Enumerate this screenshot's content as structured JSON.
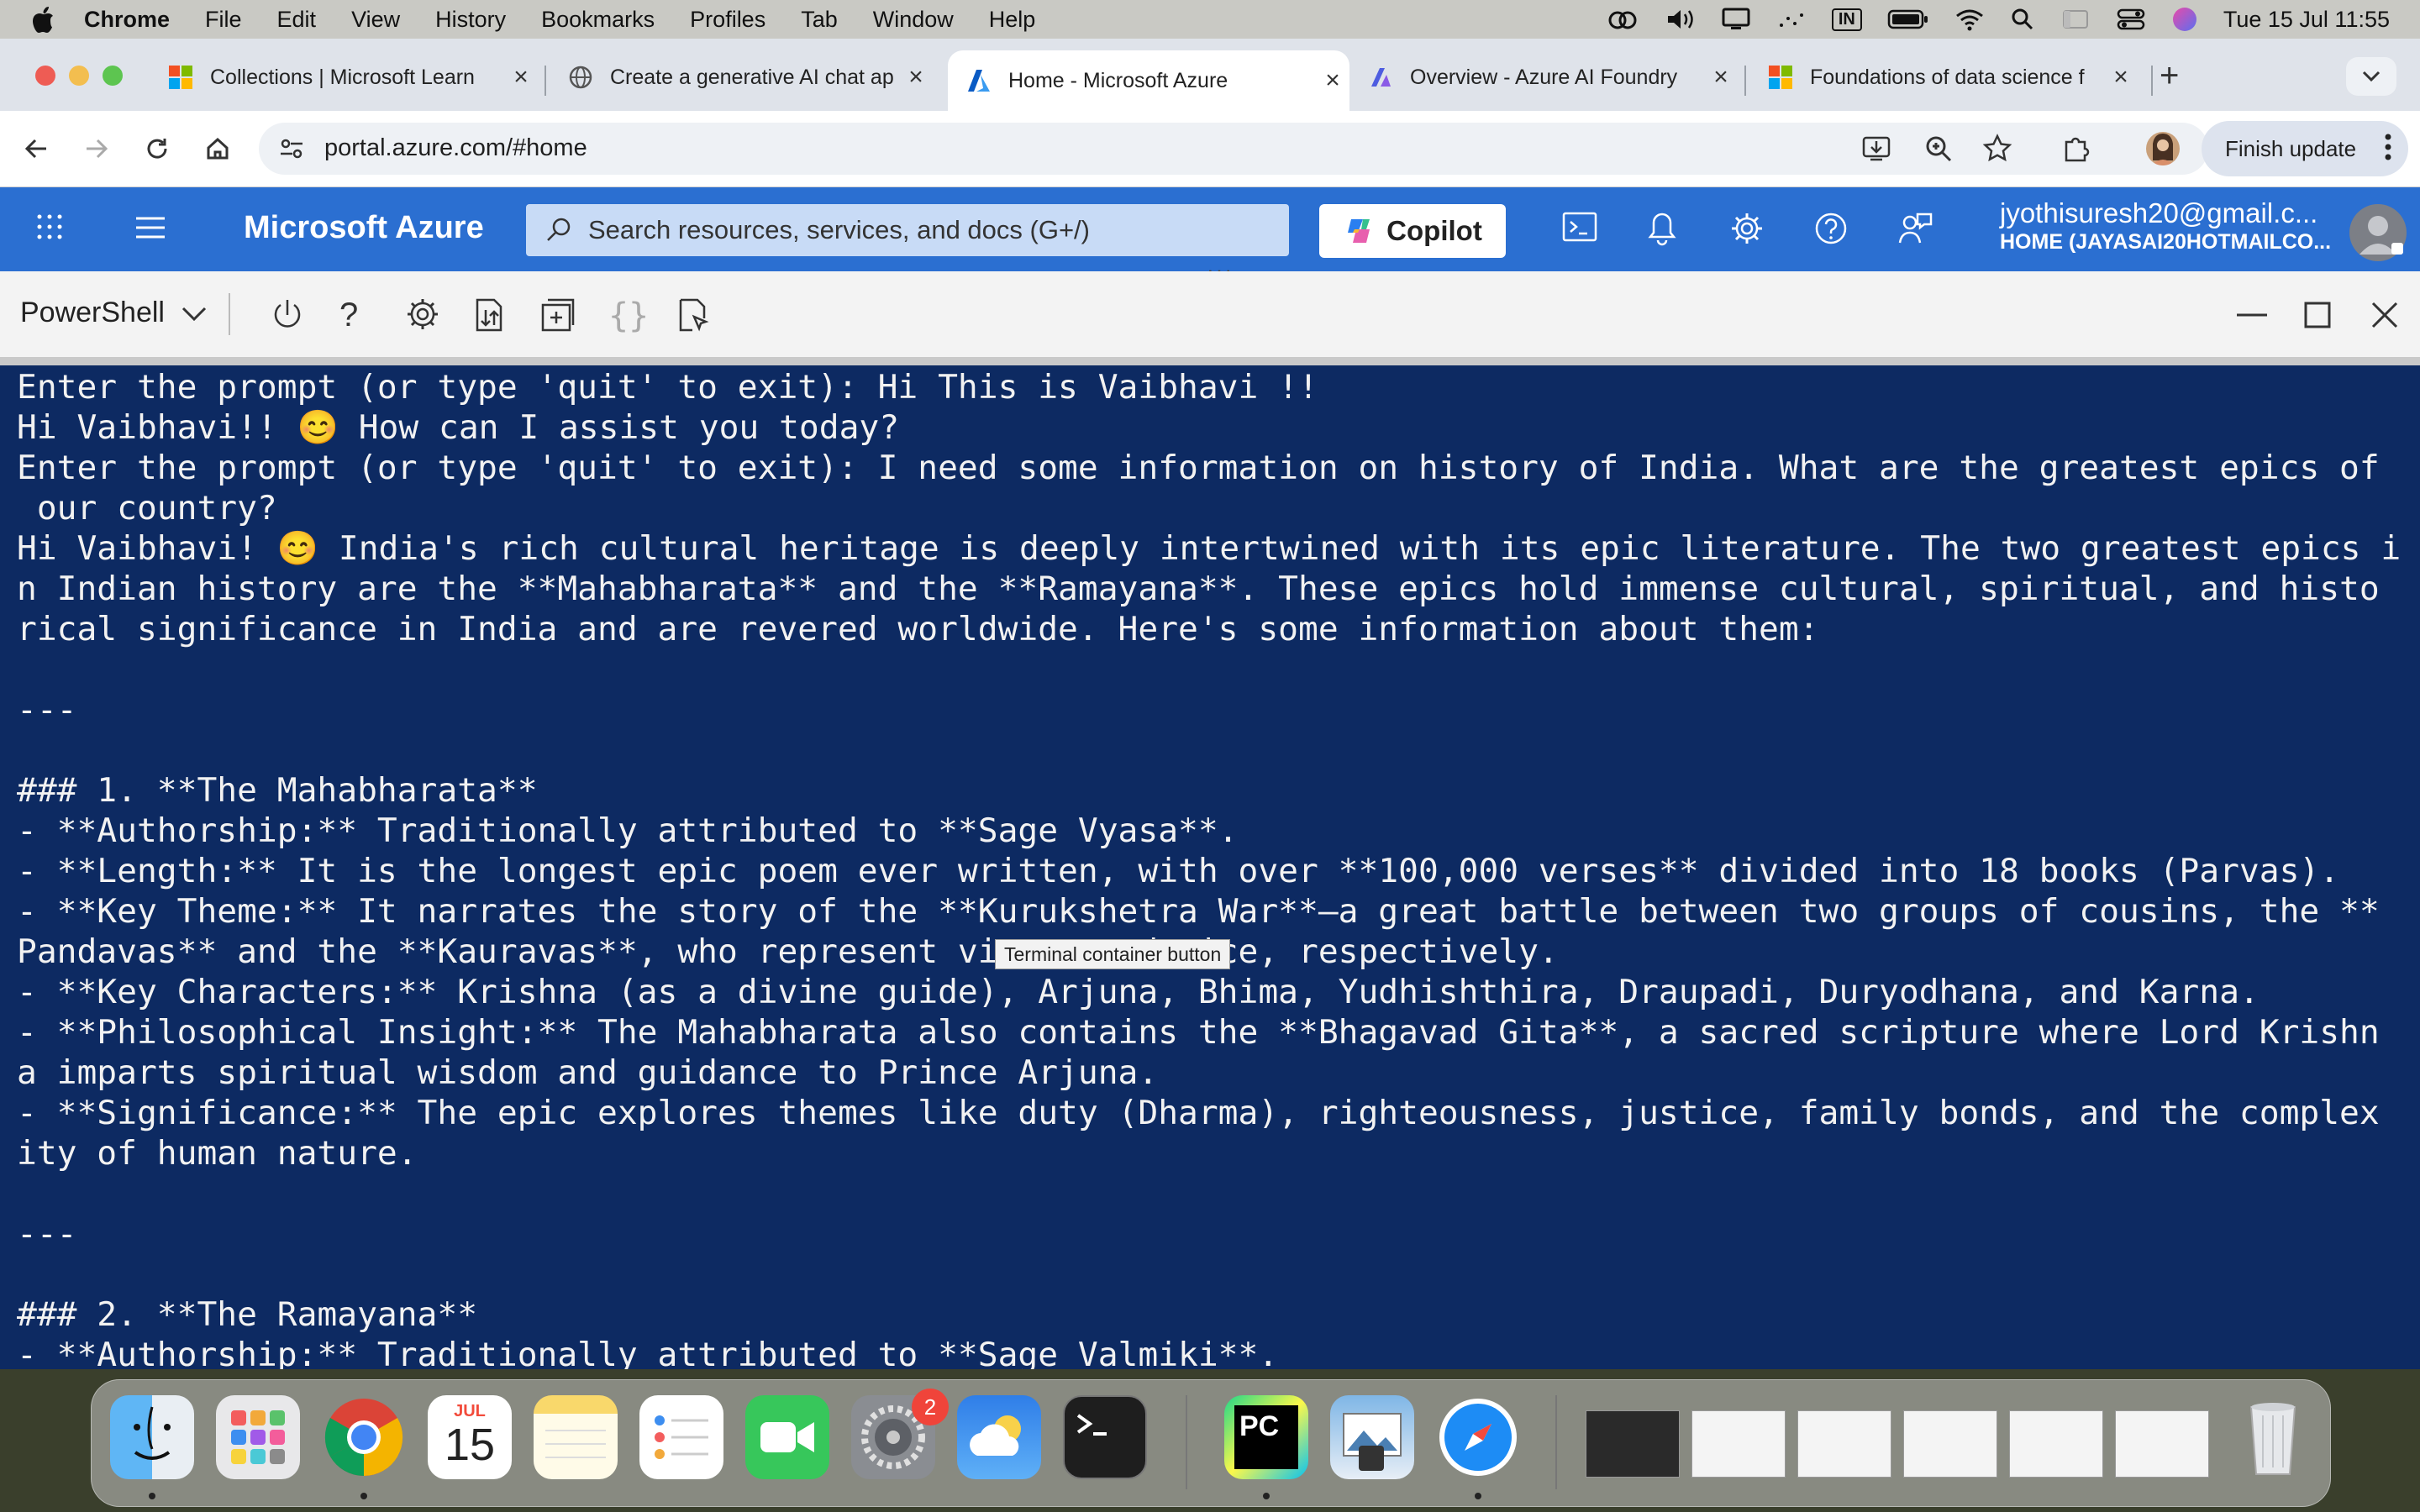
{
  "menubar": {
    "app": "Chrome",
    "items": [
      "File",
      "Edit",
      "View",
      "History",
      "Bookmarks",
      "Profiles",
      "Tab",
      "Window",
      "Help"
    ],
    "input_source": "IN",
    "clock": "Tue 15 Jul  11:55"
  },
  "tabs": [
    {
      "title": "Collections | Microsoft Learn",
      "icon": "microsoft-logo-icon"
    },
    {
      "title": "Create a generative AI chat ap",
      "icon": "globe-icon"
    },
    {
      "title": "Home - Microsoft Azure",
      "icon": "azure-logo-icon",
      "active": true
    },
    {
      "title": "Overview - Azure AI Foundry",
      "icon": "ai-foundry-icon"
    },
    {
      "title": "Foundations of data science f",
      "icon": "microsoft-logo-icon"
    }
  ],
  "toolbar": {
    "url": "portal.azure.com/#home",
    "finish_update": "Finish update"
  },
  "azure": {
    "brand": "Microsoft Azure",
    "search_placeholder": "Search resources, services, and docs (G+/)",
    "copilot": "Copilot",
    "account_user": "jyothisuresh20@gmail.c...",
    "account_dir": "HOME (JAYASAI20HOTMAILCO..."
  },
  "shell": {
    "selector": "PowerShell",
    "tooltip": "Terminal container button",
    "lines": [
      "Enter the prompt (or type 'quit' to exit): Hi This is Vaibhavi !!",
      "Hi Vaibhavi!! 😊 How can I assist you today?",
      "Enter the prompt (or type 'quit' to exit): I need some information on history of India. What are the greatest epics of",
      " our country?",
      "Hi Vaibhavi! 😊 India's rich cultural heritage is deeply intertwined with its epic literature. The two greatest epics i",
      "n Indian history are the **Mahabharata** and the **Ramayana**. These epics hold immense cultural, spiritual, and histo",
      "rical significance in India and are revered worldwide. Here's some information about them:",
      "",
      "---",
      "",
      "### 1. **The Mahabharata**",
      "- **Authorship:** Traditionally attributed to **Sage Vyasa**.",
      "- **Length:** It is the longest epic poem ever written, with over **100,000 verses** divided into 18 books (Parvas).",
      "- **Key Theme:** It narrates the story of the **Kurukshetra War**—a great battle between two groups of cousins, the **",
      "Pandavas** and the **Kauravas**, who represent virtue and vice, respectively.",
      "- **Key Characters:** Krishna (as a divine guide), Arjuna, Bhima, Yudhishthira, Draupadi, Duryodhana, and Karna.",
      "- **Philosophical Insight:** The Mahabharata also contains the **Bhagavad Gita**, a sacred scripture where Lord Krishn",
      "a imparts spiritual wisdom and guidance to Prince Arjuna.",
      "- **Significance:** The epic explores themes like duty (Dharma), righteousness, justice, family bonds, and the complex",
      "ity of human nature.",
      "",
      "---",
      "",
      "### 2. **The Ramayana**",
      "- **Authorship:** Traditionally attributed to **Sage Valmiki**."
    ]
  },
  "dock": {
    "calendar_month": "JUL",
    "calendar_day": "15",
    "settings_badge": "2",
    "pycharm_label": "PC"
  }
}
